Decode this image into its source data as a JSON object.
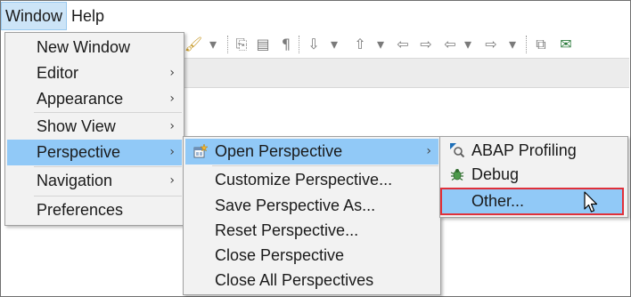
{
  "menubar": {
    "window": "Window",
    "help": "Help"
  },
  "window_menu": {
    "items": [
      {
        "label": "New Window"
      },
      {
        "label": "Editor",
        "submenu": true
      },
      {
        "label": "Appearance",
        "submenu": true
      },
      {
        "label": "Show View",
        "submenu": true
      },
      {
        "label": "Perspective",
        "submenu": true,
        "highlighted": true
      },
      {
        "label": "Navigation",
        "submenu": true
      },
      {
        "label": "Preferences"
      }
    ]
  },
  "perspective_menu": {
    "items": [
      {
        "label": "Open Perspective",
        "submenu": true,
        "highlighted": true,
        "icon": "open-perspective-icon"
      },
      {
        "label": "Customize Perspective..."
      },
      {
        "label": "Save Perspective As..."
      },
      {
        "label": "Reset Perspective..."
      },
      {
        "label": "Close Perspective"
      },
      {
        "label": "Close All Perspectives"
      }
    ]
  },
  "open_perspective_menu": {
    "items": [
      {
        "label": "ABAP Profiling",
        "icon": "abap-profiling-icon"
      },
      {
        "label": "Debug",
        "icon": "debug-icon"
      },
      {
        "label": "Other...",
        "highlighted": true
      }
    ]
  },
  "colors": {
    "highlight": "#91c9f7",
    "menu_bg": "#f2f2f2",
    "callout": "#e0303a"
  },
  "arrow_glyph": "›"
}
